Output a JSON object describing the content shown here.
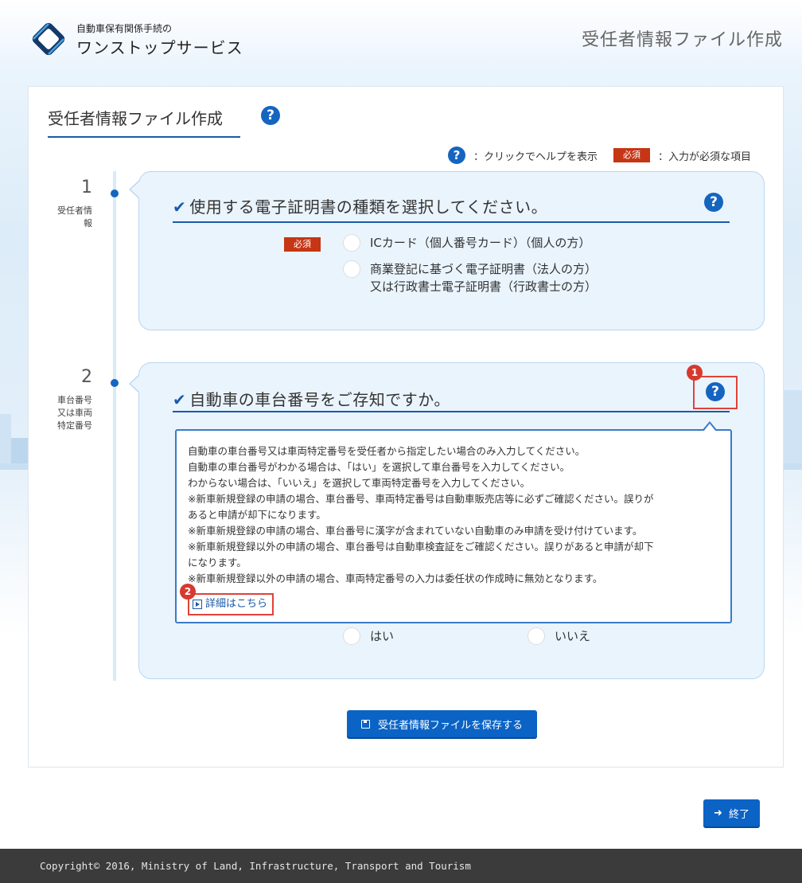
{
  "header": {
    "brand_small": "自動車保有関係手続の",
    "brand_large": "ワンストップサービス",
    "page_title": "受任者情報ファイル作成"
  },
  "card": {
    "title": "受任者情報ファイル作成",
    "help_icon": "help-circle-icon",
    "legend": {
      "help_text": "：クリックでヘルプを表示",
      "required_badge": "必須",
      "required_text": "：入力が必須な項目"
    }
  },
  "steps": [
    {
      "number": "1",
      "label_lines": [
        "受任者情",
        "報"
      ],
      "question": "使用する電子証明書の種類を選択してください。",
      "required_badge": "必須",
      "options": [
        {
          "lines": [
            "ICカード（個人番号カード）（個人の方）"
          ]
        },
        {
          "lines": [
            "商業登記に基づく電子証明書（法人の方）",
            "又は行政書士電子証明書（行政書士の方）"
          ]
        }
      ]
    },
    {
      "number": "2",
      "label_lines": [
        "車台番号",
        "又は車両",
        "特定番号"
      ],
      "question": "自動車の車台番号をご存知ですか。",
      "tooltip_lines": [
        "自動車の車台番号又は車両特定番号を受任者から指定したい場合のみ入力してください。",
        "自動車の車台番号がわかる場合は、「はい」を選択して車台番号を入力してください。",
        "わからない場合は、「いいえ」を選択して車両特定番号を入力してください。",
        "※新車新規登録の申請の場合、車台番号、車両特定番号は自動車販売店等に必ずご確認ください。誤りが",
        "あると申請が却下になります。",
        "※新車新規登録の申請の場合、車台番号に漢字が含まれていない自動車のみ申請を受け付けています。",
        "※新車新規登録以外の申請の場合、車台番号は自動車検査証をご確認ください。誤りがあると申請が却下",
        "になります。",
        "※新車新規登録以外の申請の場合、車両特定番号の入力は委任状の作成時に無効となります。"
      ],
      "detail_link": "詳細はこちら",
      "options": [
        {
          "label": "はい"
        },
        {
          "label": "いいえ"
        }
      ]
    }
  ],
  "markers": [
    "1",
    "2"
  ],
  "buttons": {
    "save": "受任者情報ファイルを保存する",
    "exit": "終了"
  },
  "footer": {
    "copyright": "Copyright© 2016, Ministry of Land, Infrastructure, Transport and Tourism"
  },
  "colors": {
    "accent": "#1565c0",
    "required": "#c63514",
    "highlight": "#e0423a",
    "footer_bg": "#3b3b3b"
  }
}
